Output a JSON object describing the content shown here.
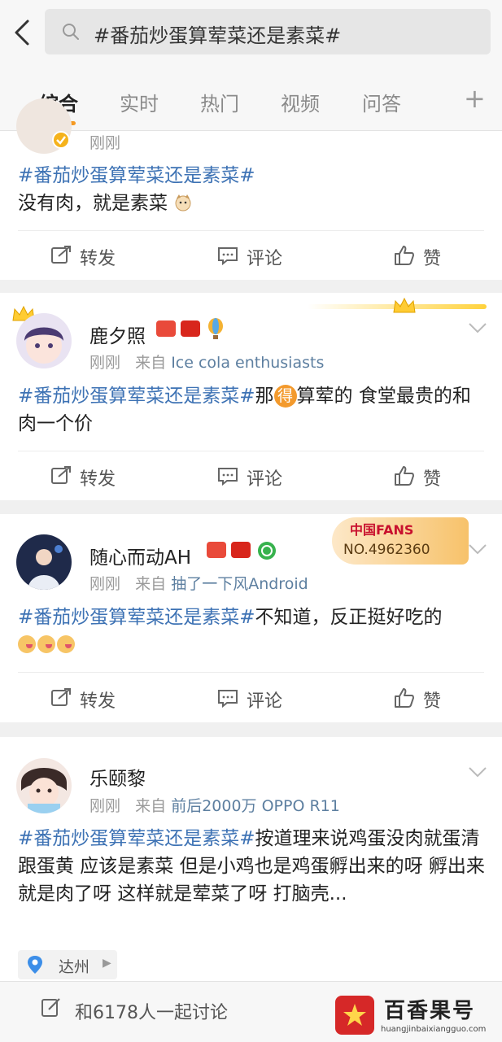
{
  "search": {
    "query": "#番茄炒蛋算荤菜还是素菜#"
  },
  "tabs": [
    {
      "label": "综合"
    },
    {
      "label": "实时"
    },
    {
      "label": "热门"
    },
    {
      "label": "视频"
    },
    {
      "label": "问答"
    }
  ],
  "tab_add": "+",
  "actions": {
    "repost": "转发",
    "comment": "评论",
    "like": "赞"
  },
  "posts": [
    {
      "time": "刚刚",
      "hashtag": "#番茄炒蛋算荤菜还是素菜#",
      "text": "没有肉，就是素菜"
    },
    {
      "name": "鹿夕照",
      "time": "刚刚",
      "from_prefix": "来自",
      "source": "Ice cola enthusiasts",
      "vip": "VIP6",
      "hashtag": "#番茄炒蛋算荤菜还是素菜#",
      "text_a": "那",
      "inline_char": "得",
      "text_b": "算荤的 食堂最贵的和肉一个价"
    },
    {
      "name": "随心而动AH",
      "time": "刚刚",
      "from_prefix": "来自",
      "source": "抽了一下风Android",
      "vip": "VIP3",
      "fans_title": "中国FANS",
      "fans_no": "NO.4962360",
      "hashtag": "#番茄炒蛋算荤菜还是素菜#",
      "text": "不知道，反正挺好吃的"
    },
    {
      "name": "乐颐黎",
      "time": "刚刚",
      "from_prefix": "来自",
      "source": "前后2000万 OPPO R11",
      "hashtag": "#番茄炒蛋算荤菜还是素菜#",
      "text": "按道理来说鸡蛋没肉就蛋清跟蛋黄  应该是素菜  但是小鸡也是鸡蛋孵出来的呀  孵出来就是肉了呀 这样就是荤菜了呀   打脑壳...",
      "location": "达州"
    }
  ],
  "bottom": {
    "discuss": "和6178人一起讨论"
  },
  "watermark": {
    "title": "百香果号",
    "url": "huangjinbaixiangguo.com"
  },
  "colors": {
    "accent": "#f59a23",
    "hashtag": "#3d72b4",
    "source": "#5d7fa0"
  }
}
